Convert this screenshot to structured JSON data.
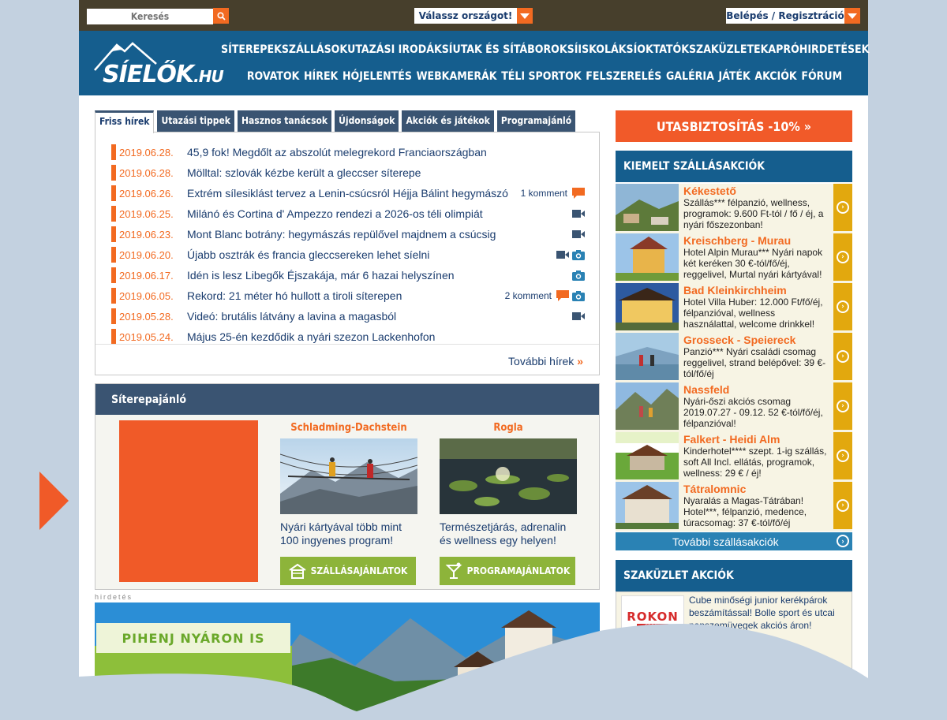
{
  "topbar": {
    "search_placeholder": "Keresés",
    "country_label": "Válassz országot!",
    "login_label": "Belépés / Regisztráció"
  },
  "logo": {
    "main": "SÍELŐK",
    "suffix": ".HU"
  },
  "nav": {
    "row1": [
      "SÍTEREPEK",
      "SZÁLLÁSOK",
      "UTAZÁSI IRODÁK",
      "SÍUTAK ÉS SÍTÁBOROK",
      "SÍISKOLÁK",
      "SÍOKTATÓK",
      "SZAKÜZLETEK",
      "APRÓHIRDETÉSEK"
    ],
    "row2": [
      "ROVATOK",
      "HÍREK",
      "HÓJELENTÉS",
      "WEBKAMERÁK",
      "TÉLI SPORTOK",
      "FELSZERELÉS",
      "GALÉRIA",
      "JÁTÉK",
      "AKCIÓK",
      "FÓRUM"
    ]
  },
  "news": {
    "tabs": [
      "Friss hírek",
      "Utazási tippek",
      "Hasznos tanácsok",
      "Újdonságok",
      "Akciók és játékok",
      "Programajánló"
    ],
    "items": [
      {
        "date": "2019.06.28.",
        "title": "45,9 fok! Megdőlt az abszolút melegrekord Franciaországban",
        "comments": "",
        "video": false,
        "photo": false
      },
      {
        "date": "2019.06.28.",
        "title": "Mölltal: szlovák kézbe került a gleccser síterepe",
        "comments": "",
        "video": false,
        "photo": false
      },
      {
        "date": "2019.06.26.",
        "title": "Extrém sílesiklást tervez a Lenin-csúcsról Héjja Bálint hegymászó",
        "comments": "1 komment",
        "video": false,
        "photo": false
      },
      {
        "date": "2019.06.25.",
        "title": "Milánó és Cortina d' Ampezzo rendezi a 2026-os téli olimpiát",
        "comments": "",
        "video": true,
        "photo": false
      },
      {
        "date": "2019.06.23.",
        "title": "Mont Blanc botrány: hegymászás repülővel majdnem a csúcsig",
        "comments": "",
        "video": true,
        "photo": false
      },
      {
        "date": "2019.06.20.",
        "title": "Újabb osztrák és francia gleccsereken lehet síelni",
        "comments": "",
        "video": true,
        "photo": true
      },
      {
        "date": "2019.06.17.",
        "title": "Idén is lesz Libegők Éjszakája, már 6 hazai helyszínen",
        "comments": "",
        "video": false,
        "photo": true
      },
      {
        "date": "2019.06.05.",
        "title": "Rekord: 21 méter hó hullott a tiroli síterepen",
        "comments": "2 komment",
        "video": false,
        "photo": true
      },
      {
        "date": "2019.05.28.",
        "title": "Videó: brutális látvány a lavina a magasból",
        "comments": "",
        "video": true,
        "photo": false
      },
      {
        "date": "2019.05.24.",
        "title": "Május 25-én kezdődik a nyári szezon Lackenhofon",
        "comments": "",
        "video": false,
        "photo": false
      }
    ],
    "more": "További hírek"
  },
  "resort": {
    "title": "Síterepajánló",
    "cards": [
      {
        "name": "Schladming-Dachstein",
        "desc": "Nyári kártyával több mint 100 ingyenes program!",
        "button": "SZÁLLÁSAJÁNLATOK"
      },
      {
        "name": "Rogla",
        "desc": "Természetjárás, adrenalin és wellness egy helyen!",
        "button": "PROGRAMAJÁNLATOK"
      }
    ]
  },
  "ad": {
    "label": "hirdetés",
    "banner_text": "PIHENJ NYÁRON IS"
  },
  "insurance": {
    "label": "UTASBIZTOSÍTÁS -10% »"
  },
  "accommodation": {
    "title": "KIEMELT SZÁLLÁSAKCIÓK",
    "items": [
      {
        "name": "Kékestető",
        "desc": "Szállás*** félpanzió, wellness, programok: 9.600 Ft-tól / fő / éj, a nyári főszezonban!"
      },
      {
        "name": "Kreischberg - Murau",
        "desc": "Hotel Alpin Murau*** Nyári napok két keréken 30 €-tól/fő/éj, reggelivel, Murtal nyári kártyával!"
      },
      {
        "name": "Bad Kleinkirchheim",
        "desc": "Hotel Villa Huber: 12.000 Ft/fő/éj, félpanzióval, wellness használattal, welcome drinkkel!"
      },
      {
        "name": "Grosseck - Speiereck",
        "desc": "Panzió*** Nyári családi csomag reggelivel, strand belépővel: 39 €-tól/fő/éj"
      },
      {
        "name": "Nassfeld",
        "desc": "Nyári-őszi akciós csomag 2019.07.27 - 09.12. 52 €-tól/fő/éj, félpanzióval!"
      },
      {
        "name": "Falkert - Heidi Alm",
        "desc": "Kinderhotel**** szept. 1-ig szállás, soft All Incl. ellátás, programok, wellness: 29 € / éj!"
      },
      {
        "name": "Tátralomnic",
        "desc": "Nyaralás a Magas-Tátrában! Hotel***, félpanzió, medence, túracsomag: 37 €-tól/fő/éj"
      }
    ],
    "more": "További szállásakciók"
  },
  "shop": {
    "title": "SZAKÜZLET AKCIÓK",
    "logo_name": "ROKON",
    "logo_sub": "SPORT",
    "text": "Cube minőségi junior kerékpárok beszámítással! Bolle sport és utcai napszemüvegek akciós áron!"
  },
  "colors": {
    "accent": "#f26a21",
    "nav": "#155e8e",
    "dark": "#473f2c",
    "tab": "#3a5472"
  }
}
